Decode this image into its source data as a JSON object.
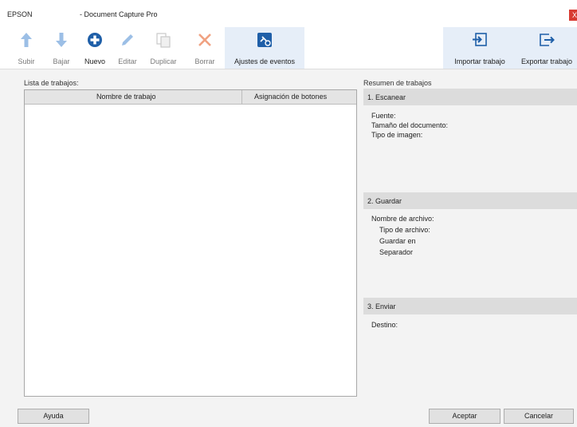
{
  "window": {
    "brand": "EPSON",
    "app_title": "- Document Capture Pro",
    "close_glyph": "X"
  },
  "toolbar": {
    "items": [
      {
        "label": "Subir",
        "icon": "arrow-up-icon",
        "enabled": false
      },
      {
        "label": "Bajar",
        "icon": "arrow-down-icon",
        "enabled": false
      },
      {
        "label": "Nuevo",
        "icon": "plus-circle-icon",
        "enabled": true
      },
      {
        "label": "Editar",
        "icon": "pencil-icon",
        "enabled": false
      },
      {
        "label": "Duplicar",
        "icon": "duplicate-icon",
        "enabled": false
      },
      {
        "label": "Borrar",
        "icon": "delete-x-icon",
        "enabled": false
      },
      {
        "label": "Ajustes de eventos",
        "icon": "event-settings-icon",
        "enabled": true
      },
      {
        "label": "Importar trabajo",
        "icon": "import-icon",
        "enabled": true
      },
      {
        "label": "Exportar trabajo",
        "icon": "export-icon",
        "enabled": true
      }
    ]
  },
  "job_list": {
    "label": "Lista de trabajos:",
    "columns": [
      "Nombre de trabajo",
      "Asignación de botones"
    ],
    "rows": []
  },
  "summary": {
    "label": "Resumen de trabajos",
    "scan": {
      "header": "1. Escanear",
      "fields": [
        "Fuente:",
        "Tamaño del documento:",
        "Tipo de imagen:"
      ]
    },
    "save": {
      "header": "2. Guardar",
      "fields": [
        "Nombre de archivo:",
        "Tipo de archivo:",
        "Guardar en",
        "Separador"
      ]
    },
    "send": {
      "header": "3. Enviar",
      "fields": [
        "Destino:"
      ]
    }
  },
  "buttons": {
    "help": "Ayuda",
    "ok": "Aceptar",
    "cancel": "Cancelar"
  },
  "colors": {
    "accent_blue": "#1f5fa8",
    "disabled_blue": "#8fb6e0",
    "delete_orange": "#f0a282",
    "close_red": "#d83b32"
  }
}
